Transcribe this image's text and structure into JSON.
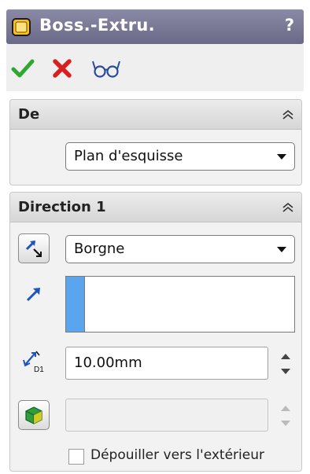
{
  "titlebar": {
    "title": "Boss.-Extru.",
    "icon": "boss-extrude-feature-icon",
    "help": "?"
  },
  "actions": [
    {
      "icon": "ok-checkmark-icon",
      "color": "#2fa82f"
    },
    {
      "icon": "cancel-x-icon",
      "color": "#d82020"
    },
    {
      "icon": "preview-glasses-icon",
      "color": "#2a4b9a"
    }
  ],
  "from_group": {
    "title": "De",
    "start_condition": "Plan d'esquisse"
  },
  "direction1_group": {
    "title": "Direction 1",
    "end_condition": "Borgne",
    "depth": "10.00mm",
    "draft_value": "",
    "draft_outward_label": "Dépouiller vers l'extérieur",
    "draft_outward_checked": false
  },
  "colors": {
    "titlebar": "#7a7a96",
    "selection_stripe": "#5aa5ee",
    "draft_icon": "#2e9e3c"
  }
}
